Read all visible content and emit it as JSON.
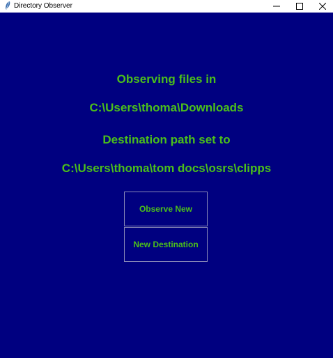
{
  "window": {
    "title": "Directory Observer",
    "icon": "feather-icon",
    "background_color": "#000080",
    "text_color": "#4bbf1a"
  },
  "main": {
    "observing_label": "Observing files in",
    "observing_path": "C:\\Users\\thoma\\Downloads",
    "destination_label": "Destination path set to",
    "destination_path": "C:\\Users\\thoma\\tom docs\\osrs\\clipps"
  },
  "buttons": {
    "observe_new": "Observe New",
    "new_destination": "New Destination"
  }
}
